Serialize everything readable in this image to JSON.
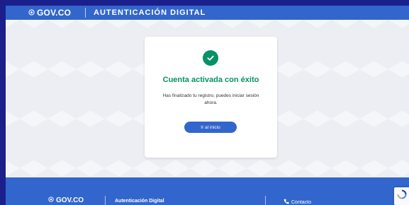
{
  "header": {
    "brand": "GOV.CO",
    "app_title": "AUTENTICACIÓN DIGITAL"
  },
  "card": {
    "title": "Cuenta activada con éxito",
    "description": "Has finalizado tu registro, puedes iniciar sesión ahora.",
    "button_label": "Ir al inicio"
  },
  "footer": {
    "brand": "GOV.CO",
    "app_title": "Autenticación Digital",
    "contact_label": "Contacto"
  },
  "colors": {
    "page_border": "#1a1f8c",
    "primary": "#3366cc",
    "success": "#069169",
    "background": "#eceef4"
  },
  "icons": {
    "brand_logo": "gov-shield-icon",
    "success": "check-circle-icon",
    "contact": "phone-icon",
    "captcha": "recaptcha-icon"
  }
}
